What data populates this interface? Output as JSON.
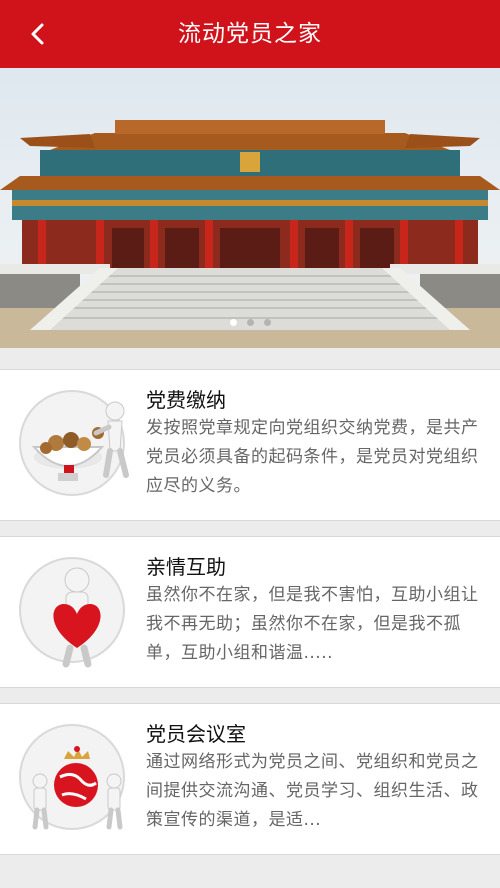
{
  "header": {
    "title": "流动党员之家",
    "back_icon": "back-arrow-icon"
  },
  "banner": {
    "image": "temple-hall-photo",
    "dots_count": 3,
    "active_dot": 1
  },
  "cards": [
    {
      "title": "党费缴纳",
      "desc": "发按照党章规定向党组织交纳党费，是共产党员必须具备的起码条件，是党员对党组织应尽的义务。",
      "icon": "donation-bowl-icon"
    },
    {
      "title": "亲情互助",
      "desc": "虽然你不在家，但是我不害怕，互助小组让我不再无助；虽然你不在家，但是我不孤单，互助小组和谐温.....",
      "icon": "heart-figure-icon"
    },
    {
      "title": "党员会议室",
      "desc": "通过网络形式为党员之间、党组织和党员之间提供交流沟通、党员学习、组织生活、政策宣传的渠道，是适...",
      "icon": "globe-meeting-icon"
    }
  ]
}
